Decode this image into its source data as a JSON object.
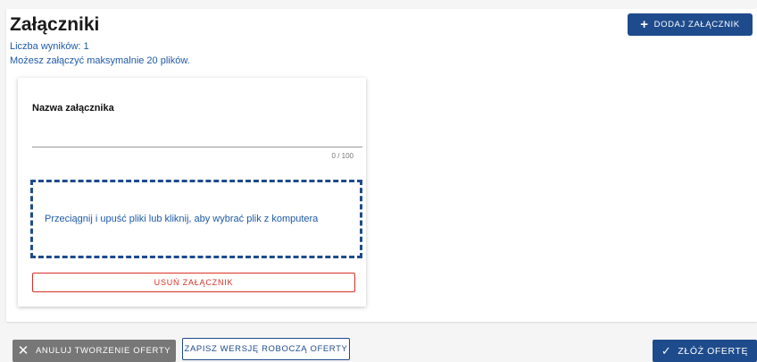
{
  "attachments": {
    "title": "Załączniki",
    "result_count": "Liczba wyników: 1",
    "limit_note": "Możesz załączyć maksymalnie 20 plików.",
    "add_button": "DODAJ ZAŁĄCZNIK",
    "card": {
      "name_label": "Nazwa załącznika",
      "name_value": "",
      "char_counter": "0 / 100",
      "dropzone_text": "Przeciągnij i upuść pliki lub kliknij, aby wybrać plik z komputera",
      "remove_button": "USUŃ ZAŁĄCZNIK"
    }
  },
  "footer": {
    "cancel_button": "ANULUJ TWORZENIE OFERTY",
    "draft_button": "ZAPISZ WERSJĘ ROBOCZĄ OFERTY",
    "submit_button": "ZŁÓŻ OFERTĘ"
  },
  "icons": {
    "add": "plus-icon",
    "cancel": "close-icon",
    "submit": "check-icon"
  },
  "colors": {
    "primary": "#1e4b8c",
    "link_text": "#1e5aa8",
    "danger": "#d93025",
    "neutral_button": "#777777"
  }
}
